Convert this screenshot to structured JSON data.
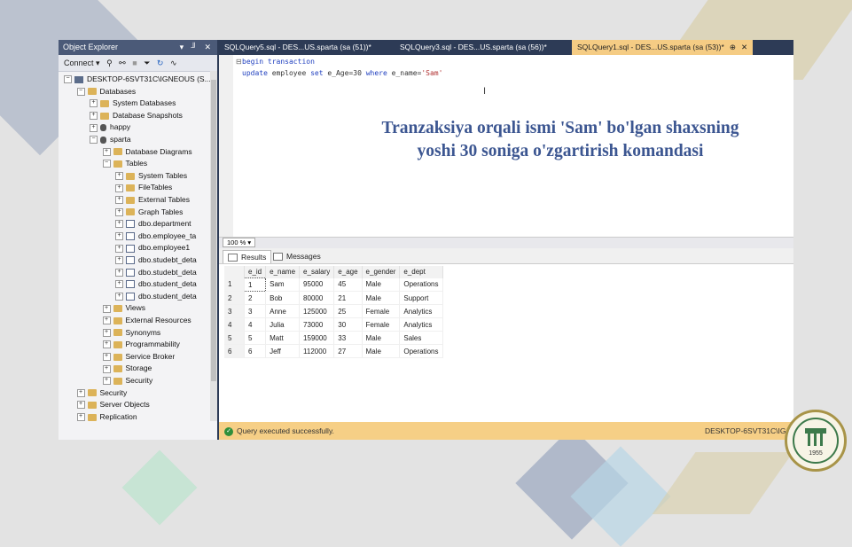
{
  "object_explorer": {
    "title": "Object Explorer",
    "window_controls": "▾ ╜ ✕",
    "toolbar": {
      "connect_label": "Connect ▾",
      "icons": [
        "connect-icon",
        "disconnect-icon",
        "stop-icon",
        "filter-icon",
        "refresh-icon",
        "activity-icon"
      ]
    },
    "tree": [
      {
        "label": "DESKTOP-6SVT31C\\IGNEOUS (S...",
        "level": 0,
        "expanded": true,
        "icon": "server"
      },
      {
        "label": "Databases",
        "level": 1,
        "expanded": true,
        "icon": "folder"
      },
      {
        "label": "System Databases",
        "level": 2,
        "expanded": false,
        "icon": "folder"
      },
      {
        "label": "Database Snapshots",
        "level": 2,
        "expanded": false,
        "icon": "folder"
      },
      {
        "label": "happy",
        "level": 2,
        "expanded": false,
        "icon": "database"
      },
      {
        "label": "sparta",
        "level": 2,
        "expanded": true,
        "icon": "database"
      },
      {
        "label": "Database Diagrams",
        "level": 3,
        "expanded": false,
        "icon": "folder"
      },
      {
        "label": "Tables",
        "level": 3,
        "expanded": true,
        "icon": "folder"
      },
      {
        "label": "System Tables",
        "level": 4,
        "expanded": false,
        "icon": "folder"
      },
      {
        "label": "FileTables",
        "level": 4,
        "expanded": false,
        "icon": "folder"
      },
      {
        "label": "External Tables",
        "level": 4,
        "expanded": false,
        "icon": "folder"
      },
      {
        "label": "Graph Tables",
        "level": 4,
        "expanded": false,
        "icon": "folder"
      },
      {
        "label": "dbo.department",
        "level": 4,
        "expanded": false,
        "icon": "table"
      },
      {
        "label": "dbo.employee_ta",
        "level": 4,
        "expanded": false,
        "icon": "table"
      },
      {
        "label": "dbo.employee1",
        "level": 4,
        "expanded": false,
        "icon": "table"
      },
      {
        "label": "dbo.studebt_deta",
        "level": 4,
        "expanded": false,
        "icon": "table"
      },
      {
        "label": "dbo.studebt_deta",
        "level": 4,
        "expanded": false,
        "icon": "table"
      },
      {
        "label": "dbo.student_deta",
        "level": 4,
        "expanded": false,
        "icon": "table"
      },
      {
        "label": "dbo.student_deta",
        "level": 4,
        "expanded": false,
        "icon": "table"
      },
      {
        "label": "Views",
        "level": 3,
        "expanded": false,
        "icon": "folder"
      },
      {
        "label": "External Resources",
        "level": 3,
        "expanded": false,
        "icon": "folder"
      },
      {
        "label": "Synonyms",
        "level": 3,
        "expanded": false,
        "icon": "folder"
      },
      {
        "label": "Programmability",
        "level": 3,
        "expanded": false,
        "icon": "folder"
      },
      {
        "label": "Service Broker",
        "level": 3,
        "expanded": false,
        "icon": "folder"
      },
      {
        "label": "Storage",
        "level": 3,
        "expanded": false,
        "icon": "folder"
      },
      {
        "label": "Security",
        "level": 3,
        "expanded": false,
        "icon": "folder"
      },
      {
        "label": "Security",
        "level": 1,
        "expanded": false,
        "icon": "folder"
      },
      {
        "label": "Server Objects",
        "level": 1,
        "expanded": false,
        "icon": "folder"
      },
      {
        "label": "Replication",
        "level": 1,
        "expanded": false,
        "icon": "folder"
      }
    ]
  },
  "tabs": [
    {
      "label": "SQLQuery5.sql - DES...US.sparta (sa (51))*",
      "active": false
    },
    {
      "label": "SQLQuery3.sql - DES...US.sparta (sa (56))*",
      "active": false
    },
    {
      "label": "SQLQuery1.sql - DES...US.sparta (sa (53))*",
      "active": true,
      "pin": "⊕",
      "close": "✕"
    }
  ],
  "editor": {
    "line1": {
      "kw1": "begin",
      "kw2": " transaction"
    },
    "line2": {
      "kw1": "update",
      "t1": " employee ",
      "kw2": "set",
      "t2": " e_Age=30 ",
      "kw3": "where",
      "t3": " e_name=",
      "str": "'Sam'"
    }
  },
  "overlay_text": "Tranzaksiya orqali ismi 'Sam' bo'lgan shaxsning yoshi 30 soniga o'zgartirish komandasi",
  "zoom": "100 %",
  "result_tabs": {
    "results": "Results",
    "messages": "Messages"
  },
  "grid": {
    "columns": [
      "e_id",
      "e_name",
      "e_salary",
      "e_age",
      "e_gender",
      "e_dept"
    ],
    "rows": [
      {
        "n": "1",
        "cells": [
          "1",
          "Sam",
          "95000",
          "45",
          "Male",
          "Operations"
        ]
      },
      {
        "n": "2",
        "cells": [
          "2",
          "Bob",
          "80000",
          "21",
          "Male",
          "Support"
        ]
      },
      {
        "n": "3",
        "cells": [
          "3",
          "Anne",
          "125000",
          "25",
          "Female",
          "Analytics"
        ]
      },
      {
        "n": "4",
        "cells": [
          "4",
          "Julia",
          "73000",
          "30",
          "Female",
          "Analytics"
        ]
      },
      {
        "n": "5",
        "cells": [
          "5",
          "Matt",
          "159000",
          "33",
          "Male",
          "Sales"
        ]
      },
      {
        "n": "6",
        "cells": [
          "6",
          "Jeff",
          "112000",
          "27",
          "Male",
          "Operations"
        ]
      }
    ]
  },
  "status": {
    "message": "Query executed successfully.",
    "server": "DESKTOP-6SVT31C\\IG",
    "ok_icon": "check-circle-icon"
  },
  "logo": {
    "year": "1955"
  },
  "colors": {
    "overlay_text": "#3c5691",
    "status_bar": "#f6cf86",
    "active_tab": "#f5cc84",
    "window_frame": "#2d3b56"
  }
}
